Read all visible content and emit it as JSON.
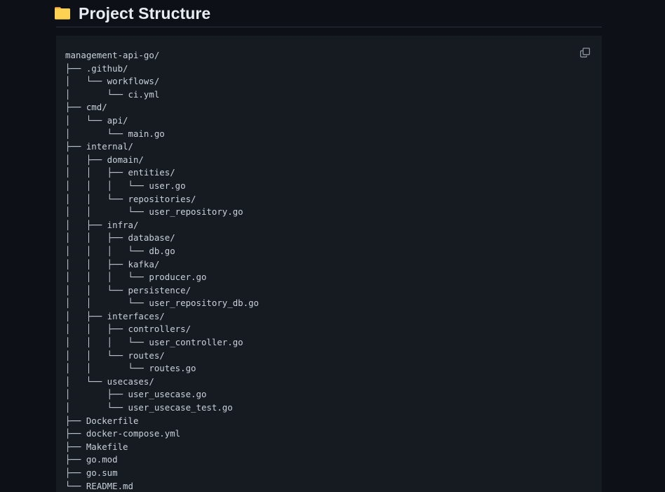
{
  "header": {
    "title": "Project Structure",
    "icon": "folder-icon",
    "icon_color": "#FFD152"
  },
  "codeblock": {
    "copy_button_label": "copy-icon",
    "language": "text",
    "background": "#161b22",
    "text_color": "#c9d1d9",
    "tree_lines": [
      "management-api-go/",
      "├── .github/",
      "│   └── workflows/",
      "│       └── ci.yml",
      "├── cmd/",
      "│   └── api/",
      "│       └── main.go",
      "├── internal/",
      "│   ├── domain/",
      "│   │   ├── entities/",
      "│   │   │   └── user.go",
      "│   │   └── repositories/",
      "│   │       └── user_repository.go",
      "│   ├── infra/",
      "│   │   ├── database/",
      "│   │   │   └── db.go",
      "│   │   ├── kafka/",
      "│   │   │   └── producer.go",
      "│   │   └── persistence/",
      "│   │       └── user_repository_db.go",
      "│   ├── interfaces/",
      "│   │   ├── controllers/",
      "│   │   │   └── user_controller.go",
      "│   │   └── routes/",
      "│   │       └── routes.go",
      "│   └── usecases/",
      "│       ├── user_usecase.go",
      "│       └── user_usecase_test.go",
      "├── Dockerfile",
      "├── docker-compose.yml",
      "├── Makefile",
      "├── go.mod",
      "├── go.sum",
      "└── README.md"
    ],
    "tree_nodes": [
      {
        "name": "management-api-go/",
        "type": "dir",
        "depth": 0
      },
      {
        "name": ".github/",
        "type": "dir",
        "depth": 1
      },
      {
        "name": "workflows/",
        "type": "dir",
        "depth": 2
      },
      {
        "name": "ci.yml",
        "type": "file",
        "depth": 3
      },
      {
        "name": "cmd/",
        "type": "dir",
        "depth": 1
      },
      {
        "name": "api/",
        "type": "dir",
        "depth": 2
      },
      {
        "name": "main.go",
        "type": "file",
        "depth": 3
      },
      {
        "name": "internal/",
        "type": "dir",
        "depth": 1
      },
      {
        "name": "domain/",
        "type": "dir",
        "depth": 2
      },
      {
        "name": "entities/",
        "type": "dir",
        "depth": 3
      },
      {
        "name": "user.go",
        "type": "file",
        "depth": 4
      },
      {
        "name": "repositories/",
        "type": "dir",
        "depth": 3
      },
      {
        "name": "user_repository.go",
        "type": "file",
        "depth": 4
      },
      {
        "name": "infra/",
        "type": "dir",
        "depth": 2
      },
      {
        "name": "database/",
        "type": "dir",
        "depth": 3
      },
      {
        "name": "db.go",
        "type": "file",
        "depth": 4
      },
      {
        "name": "kafka/",
        "type": "dir",
        "depth": 3
      },
      {
        "name": "producer.go",
        "type": "file",
        "depth": 4
      },
      {
        "name": "persistence/",
        "type": "dir",
        "depth": 3
      },
      {
        "name": "user_repository_db.go",
        "type": "file",
        "depth": 4
      },
      {
        "name": "interfaces/",
        "type": "dir",
        "depth": 2
      },
      {
        "name": "controllers/",
        "type": "dir",
        "depth": 3
      },
      {
        "name": "user_controller.go",
        "type": "file",
        "depth": 4
      },
      {
        "name": "routes/",
        "type": "dir",
        "depth": 3
      },
      {
        "name": "routes.go",
        "type": "file",
        "depth": 4
      },
      {
        "name": "usecases/",
        "type": "dir",
        "depth": 2
      },
      {
        "name": "user_usecase.go",
        "type": "file",
        "depth": 3
      },
      {
        "name": "user_usecase_test.go",
        "type": "file",
        "depth": 3
      },
      {
        "name": "Dockerfile",
        "type": "file",
        "depth": 1
      },
      {
        "name": "docker-compose.yml",
        "type": "file",
        "depth": 1
      },
      {
        "name": "Makefile",
        "type": "file",
        "depth": 1
      },
      {
        "name": "go.mod",
        "type": "file",
        "depth": 1
      },
      {
        "name": "go.sum",
        "type": "file",
        "depth": 1
      },
      {
        "name": "README.md",
        "type": "file",
        "depth": 1
      }
    ]
  },
  "theme": {
    "page_background": "#0d1117",
    "divider": "#2b313a",
    "icon_stroke": "#8b949e"
  }
}
